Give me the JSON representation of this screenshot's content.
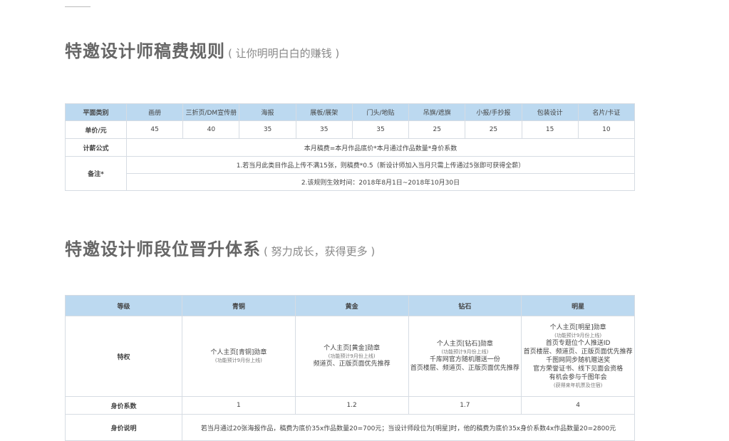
{
  "section1": {
    "title": "特邀设计师稿费规则",
    "subtitle": "( 让你明明白白的赚钱 )"
  },
  "fee_table": {
    "header_label": "平面类别",
    "categories": [
      "画册",
      "三折页/DM宣传册",
      "海报",
      "展板/展架",
      "门头/地贴",
      "吊旗/遮旗",
      "小报/手抄报",
      "包装设计",
      "名片/卡证"
    ],
    "price_label": "单价/元",
    "prices": [
      "45",
      "40",
      "35",
      "35",
      "35",
      "25",
      "25",
      "15",
      "10"
    ],
    "formula_label": "计薪公式",
    "formula": "本月稿费=本月作品底价*本月通过作品数量*身价系数",
    "notes_label": "备注*",
    "note1": "1.若当月此类目作品上传不满15张，则稿费*0.5（新设计师加入当月只需上传通过5张即可获得全薪）",
    "note2": "2.该规则生效时间：2018年8月1日~2018年10月30日"
  },
  "section2": {
    "title": "特邀设计师段位晋升体系",
    "subtitle": "( 努力成长，获得更多 )"
  },
  "rank_table": {
    "level_label": "等级",
    "levels": [
      "青铜",
      "黄金",
      "钻石",
      "明星"
    ],
    "privilege_label": "特权",
    "privileges": {
      "bronze": {
        "line1": "个人主页[青铜]勋章",
        "note": "(功能预计9月份上线)"
      },
      "gold": {
        "line1": "个人主页[黄金]勋章",
        "note": "(功能预计9月份上线)",
        "line2": "频道页、正版页面优先推荐"
      },
      "diamond": {
        "line1": "个人主页[钻石]勋章",
        "note": "(功能预计9月份上线)",
        "line2": "千库网官方随机赠送一份",
        "line3": "首页楼层、频道页、正版页面优先推荐"
      },
      "star": {
        "line1": "个人主页[明星]勋章",
        "note1": "(功能预计9月份上线)",
        "line2": "首页专题位个人推送ID",
        "line3": "首页楼层、频道页、正版页面优先推荐",
        "line4": "千图网同步随机赠送奖",
        "line5": "官方荣誉证书、线下见面会资格",
        "line6": "有机会参与千图年会",
        "note2": "(获得来年机票及住宿)"
      }
    },
    "coef_label": "身价系数",
    "coefs": [
      "1",
      "1.2",
      "1.7",
      "4"
    ],
    "desc_label": "身价说明",
    "desc": "若当月通过20张海报作品，稿费为底价35x作品数量20=700元；当设计师段位为[明星]时，他的稿费为底价35x身价系数4x作品数量20=2800元"
  }
}
